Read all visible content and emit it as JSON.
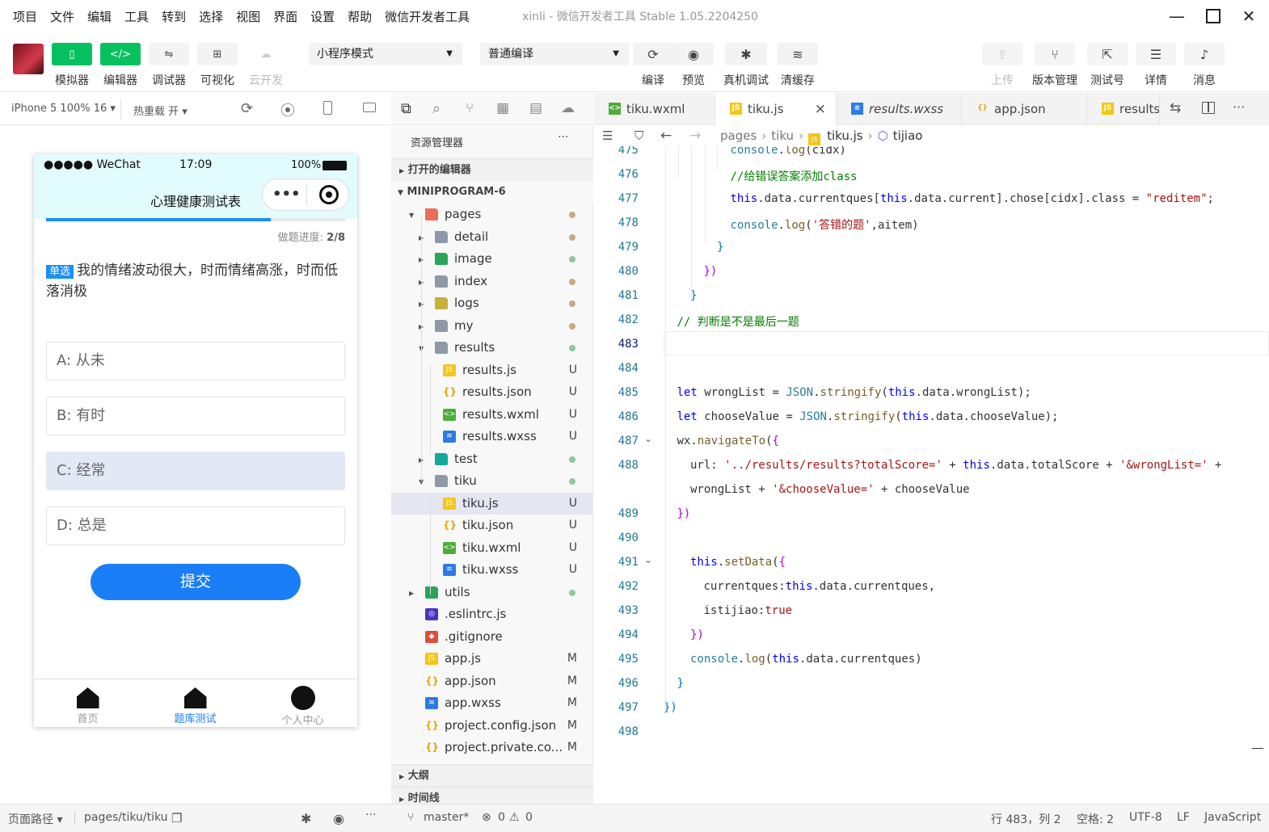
{
  "menu": [
    "项目",
    "文件",
    "编辑",
    "工具",
    "转到",
    "选择",
    "视图",
    "界面",
    "设置",
    "帮助",
    "微信开发者工具"
  ],
  "window": {
    "title": "xinli - 微信开发者工具 Stable 1.05.2204250"
  },
  "toolbar": {
    "buttons": [
      {
        "label": "模拟器",
        "icon": "phone-icon"
      },
      {
        "label": "编辑器",
        "icon": "code-icon"
      },
      {
        "label": "调试器",
        "icon": "debug-icon"
      },
      {
        "label": "可视化",
        "icon": "layout-icon"
      },
      {
        "label": "云开发",
        "icon": "cloud-icon"
      }
    ],
    "mode": "小程序模式",
    "compile": "普通编译",
    "actions": [
      {
        "label": "编译",
        "icon": "refresh-icon"
      },
      {
        "label": "预览",
        "icon": "eye-icon"
      },
      {
        "label": "真机调试",
        "icon": "bug-icon"
      },
      {
        "label": "清缓存",
        "icon": "layers-icon"
      }
    ],
    "right": [
      {
        "label": "上传",
        "icon": "upload-icon"
      },
      {
        "label": "版本管理",
        "icon": "branch-icon"
      },
      {
        "label": "测试号",
        "icon": "external-icon"
      },
      {
        "label": "详情",
        "icon": "menu-icon"
      },
      {
        "label": "消息",
        "icon": "bell-icon"
      }
    ]
  },
  "simulator": {
    "device": "iPhone 5 100% 16 ▾",
    "hotreload": "热重载 开 ▾",
    "status": {
      "carrier": "●●●●● WeChat",
      "time": "17:09",
      "battery": "100%"
    },
    "nav_title": "心理健康测试表",
    "progress": {
      "label": "做题进度:",
      "value": "2/8",
      "fraction": 0.75
    },
    "question": {
      "tag": "单选",
      "text": "我的情绪波动很大，时而情绪高涨，时而低落消极"
    },
    "options": [
      "A: 从未",
      "B: 有时",
      "C: 经常",
      "D: 总是"
    ],
    "selected": 2,
    "submit": "提交",
    "tabbar": [
      "首页",
      "题库测试",
      "个人中心"
    ]
  },
  "explorer": {
    "title": "资源管理器",
    "more": "···",
    "open_editors": "打开的编辑器",
    "project": "MINIPROGRAM-6",
    "tree": [
      {
        "name": "pages",
        "level": 1,
        "type": "folder",
        "open": true,
        "color": "#e8705b",
        "dot": "#c7a97e"
      },
      {
        "name": "detail",
        "level": 2,
        "type": "folder",
        "open": false,
        "color": "#8e99a8",
        "dot": "#c7a97e"
      },
      {
        "name": "image",
        "level": 2,
        "type": "folder",
        "open": false,
        "color": "#2ba45a",
        "dot": "#8bc99a"
      },
      {
        "name": "index",
        "level": 2,
        "type": "folder",
        "open": false,
        "color": "#8e99a8",
        "dot": "#c7a97e"
      },
      {
        "name": "logs",
        "level": 2,
        "type": "folder",
        "open": false,
        "color": "#c8b03a",
        "dot": "#c7a97e"
      },
      {
        "name": "my",
        "level": 2,
        "type": "folder",
        "open": false,
        "color": "#8e99a8",
        "dot": "#c7a97e"
      },
      {
        "name": "results",
        "level": 2,
        "type": "folder",
        "open": true,
        "color": "#8e99a8",
        "dot": "#8bc99a"
      },
      {
        "name": "results.js",
        "level": 3,
        "type": "js",
        "status": "U"
      },
      {
        "name": "results.json",
        "level": 3,
        "type": "json",
        "status": "U"
      },
      {
        "name": "results.wxml",
        "level": 3,
        "type": "wxml",
        "status": "U"
      },
      {
        "name": "results.wxss",
        "level": 3,
        "type": "wxss",
        "status": "U"
      },
      {
        "name": "test",
        "level": 2,
        "type": "folder",
        "open": false,
        "color": "#14a79c",
        "dot": "#8bc99a"
      },
      {
        "name": "tiku",
        "level": 2,
        "type": "folder",
        "open": true,
        "color": "#8e99a8",
        "dot": "#8bc99a"
      },
      {
        "name": "tiku.js",
        "level": 3,
        "type": "js",
        "status": "U",
        "selected": true
      },
      {
        "name": "tiku.json",
        "level": 3,
        "type": "json",
        "status": "U"
      },
      {
        "name": "tiku.wxml",
        "level": 3,
        "type": "wxml",
        "status": "U"
      },
      {
        "name": "tiku.wxss",
        "level": 3,
        "type": "wxss",
        "status": "U"
      },
      {
        "name": "utils",
        "level": 1,
        "type": "folder",
        "open": false,
        "color": "#2ba45a",
        "dot": "#8bc99a"
      },
      {
        "name": ".eslintrc.js",
        "level": 1,
        "type": "eslint"
      },
      {
        "name": ".gitignore",
        "level": 1,
        "type": "git"
      },
      {
        "name": "app.js",
        "level": 1,
        "type": "js",
        "status": "M"
      },
      {
        "name": "app.json",
        "level": 1,
        "type": "json",
        "status": "M"
      },
      {
        "name": "app.wxss",
        "level": 1,
        "type": "wxss",
        "status": "M"
      },
      {
        "name": "project.config.json",
        "level": 1,
        "type": "json",
        "status": "M"
      },
      {
        "name": "project.private.co...",
        "level": 1,
        "type": "json",
        "status": "M"
      }
    ],
    "outline": "大纲",
    "timeline": "时间线"
  },
  "editor": {
    "tabs": [
      {
        "name": "tiku.wxml",
        "type": "wxml"
      },
      {
        "name": "tiku.js",
        "type": "js",
        "active": true,
        "close": "×"
      },
      {
        "name": "results.wxss",
        "type": "wxss",
        "italic": true
      },
      {
        "name": "app.json",
        "type": "json"
      },
      {
        "name": "results.",
        "type": "js"
      }
    ],
    "breadcrumb": [
      "pages",
      "tiku",
      "tiku.js",
      "tijiao"
    ],
    "lines": [
      {
        "n": "475",
        "indent": 5,
        "html": "<span class='p'>console</span>.<span class='f'>log</span>(cidx)"
      },
      {
        "n": "476",
        "indent": 5,
        "html": "<span class='c'>//给错误答案添加class</span>"
      },
      {
        "n": "477",
        "indent": 5,
        "html": "<span class='k'>this</span>.data.currentques[<span class='k'>this</span>.data.current].chose[cidx].class = <span class='s'>\"reditem\"</span>;"
      },
      {
        "n": "478",
        "indent": 5,
        "html": "<span class='p'>console</span>.<span class='f'>log</span>(<span class='s'>'答错的题'</span>,aitem)"
      },
      {
        "n": "479",
        "indent": 4,
        "html": "<span class='t'>}</span>"
      },
      {
        "n": "480",
        "indent": 3,
        "html": "<span class='pn'>})</span>"
      },
      {
        "n": "481",
        "indent": 2,
        "html": "<span class='t'>}</span>"
      },
      {
        "n": "482",
        "indent": 1,
        "html": "<span class='c'>// 判断是不是最后一题</span>"
      },
      {
        "n": "483",
        "indent": 1,
        "html": ""
      },
      {
        "n": "484",
        "indent": 1,
        "html": ""
      },
      {
        "n": "485",
        "indent": 1,
        "html": "<span class='k'>let</span> wrongList = <span class='p'>JSON</span>.<span class='f'>stringify</span>(<span class='k'>this</span>.data.wrongList);"
      },
      {
        "n": "486",
        "indent": 1,
        "html": "<span class='k'>let</span> chooseValue = <span class='p'>JSON</span>.<span class='f'>stringify</span>(<span class='k'>this</span>.data.chooseValue);"
      },
      {
        "n": "487",
        "indent": 1,
        "html": "wx.<span class='f'>navigateTo</span>(<span class='pn'>{</span>"
      },
      {
        "n": "488",
        "indent": 2,
        "html": "url: <span class='s'>'../results/results?totalScore='</span> + <span class='k'>this</span>.data.totalScore + <span class='s'>'&amp;wrongList='</span> +"
      },
      {
        "n": "",
        "indent": 2,
        "html": "wrongList + <span class='s'>'&amp;chooseValue='</span> + chooseValue"
      },
      {
        "n": "489",
        "indent": 1,
        "html": "<span class='pn'>})</span>"
      },
      {
        "n": "490",
        "indent": 1,
        "html": ""
      },
      {
        "n": "491",
        "indent": 2,
        "html": "<span class='k'>this</span>.<span class='f'>setData</span>(<span class='pn'>{</span>"
      },
      {
        "n": "492",
        "indent": 3,
        "html": "currentques:<span class='k'>this</span>.data.currentques,"
      },
      {
        "n": "493",
        "indent": 3,
        "html": "istijiao:<span class='s'>true</span>"
      },
      {
        "n": "494",
        "indent": 2,
        "html": "<span class='pn'>})</span>"
      },
      {
        "n": "495",
        "indent": 2,
        "html": "<span class='p'>console</span>.<span class='f'>log</span>(<span class='k'>this</span>.data.currentques)"
      },
      {
        "n": "496",
        "indent": 1,
        "html": "<span class='t'>}</span>"
      },
      {
        "n": "497",
        "indent": 0,
        "html": "<span class='t'>})</span>"
      },
      {
        "n": "498",
        "indent": 0,
        "html": ""
      }
    ]
  },
  "statusbar": {
    "path_label": "页面路径 ▾",
    "path": "pages/tiku/tiku",
    "branch": "master*",
    "errors": "0",
    "warnings": "0",
    "cursor": "行 483，列 2",
    "spaces": "空格: 2",
    "encoding": "UTF-8",
    "eol": "LF",
    "language": "JavaScript"
  }
}
